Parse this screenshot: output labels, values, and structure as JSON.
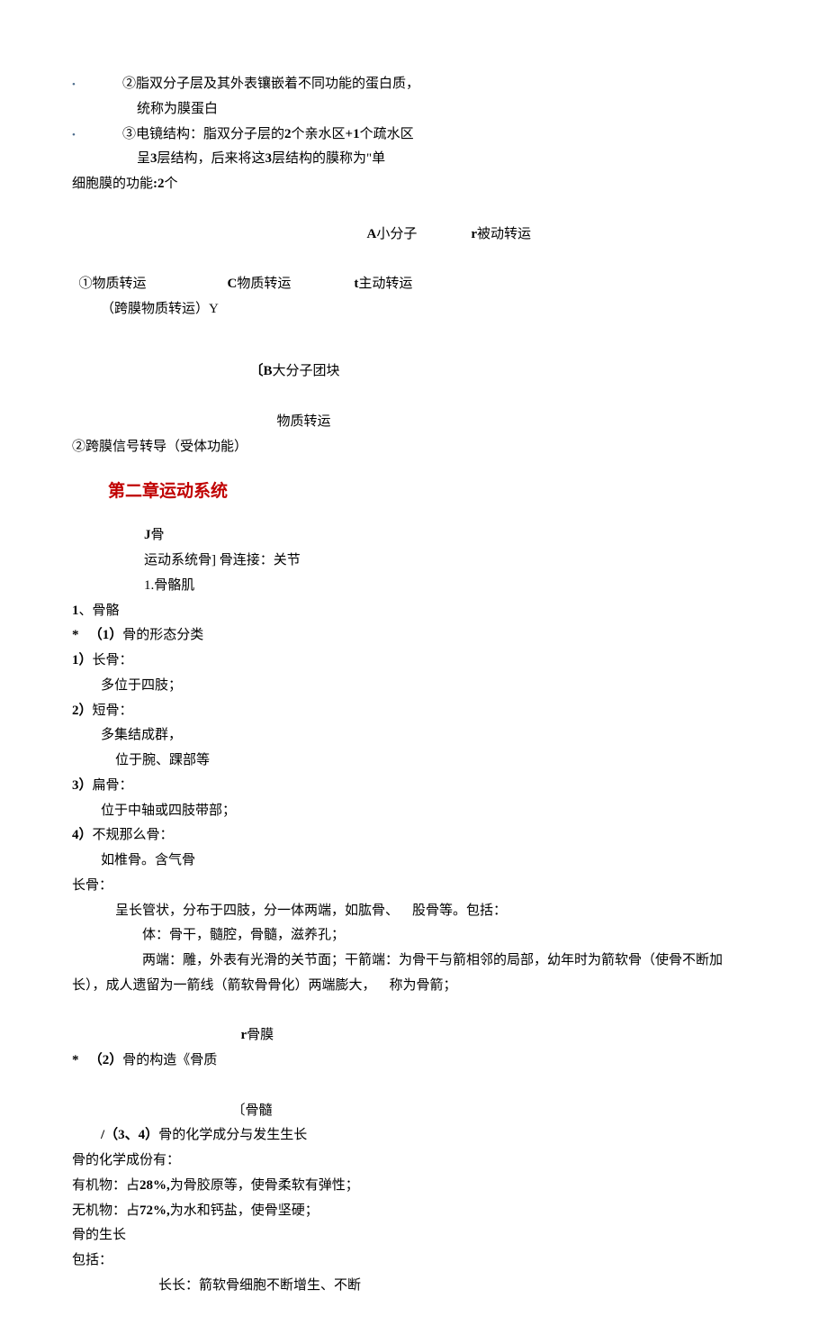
{
  "bullets": {
    "item2": "②脂双分子层及其外表镶嵌着不同功能的蛋白质，",
    "item2_cont": "统称为膜蛋白",
    "item3_a": "③电镜结构：脂双分子层的",
    "item3_b": "2",
    "item3_c": "个亲水区",
    "item3_d": "+1",
    "item3_e": "个疏水区",
    "item3_line2_a": "呈",
    "item3_line2_b": "3",
    "item3_line2_c": "层结构，后来将这",
    "item3_line2_d": "3",
    "item3_line2_e": "层结构的膜称为\"单"
  },
  "membrane_func": {
    "title_a": "细胞膜的功能",
    "title_b": ":2",
    "title_c": "个",
    "row1_A": "A",
    "row1_A_txt": "小分子",
    "row1_r": "r",
    "row1_r_txt": "被动转运",
    "row2_num": "①物质转运",
    "row2_C": "C",
    "row2_C_txt": "物质转运",
    "row2_t": "t",
    "row2_t_txt": "主动转运",
    "row3": "（跨膜物质转运）Y",
    "row4_B": "〔B",
    "row4_B_txt": "大分子团块",
    "row5_txt": "物质转运",
    "signal": "②跨膜信号转导（受体功能）"
  },
  "chapter2": "第二章运动系统",
  "motion": {
    "j": "J",
    "bone": "骨",
    "sys_a": "运动系统骨]",
    "sys_b": "骨连接：关节",
    "sk_muscle": "1.骨骼肌"
  },
  "skeleton": {
    "heading_num": "1",
    "heading_txt": "、骨骼",
    "star": "*",
    "morph_a": "（1）",
    "morph_b": "骨的形态分类",
    "long_num": "1）",
    "long_txt": "长骨：",
    "long_desc": "多位于四肢；",
    "short_num": "2）",
    "short_txt": "短骨：",
    "short_desc1": "多集结成群，",
    "short_desc2": "位于腕、踝部等",
    "flat_num": "3）",
    "flat_txt": "扁骨：",
    "flat_desc": "位于中轴或四肢带部；",
    "irr_num": "4）",
    "irr_txt": "不规那么骨：",
    "irr_desc": "如椎骨。含气骨"
  },
  "longbone": {
    "title": "长骨：",
    "line1_a": "呈长管状，分布于四肢，分一体两端，如肱骨、",
    "line1_b": "股骨等。包括：",
    "line2": "体：骨干，髓腔，骨髓，滋养孔；",
    "line3_a": "两端：雕，外表有光滑的关节面；干箭端：为骨干与箭相邻的局部，幼年时为箭软骨（使骨不断加长），成人遗留为一箭线（箭软骨骨化）两端膨大，",
    "line3_b": "称为骨箭；"
  },
  "structure": {
    "r": "r",
    "r_txt": "骨膜",
    "star": "*",
    "num": "（2）",
    "txt": "骨的构造《骨质",
    "marrow": "〔骨髓",
    "chem_num": "（3、4）",
    "chem_pre": "/",
    "chem_txt": "骨的化学成分与发生生长"
  },
  "chem": {
    "title": "骨的化学成份有：",
    "org_a": "有机物：占",
    "org_b": "28%,",
    "org_c": "为骨胶原等，使骨柔软有弹性；",
    "inorg_a": "无机物：占",
    "inorg_b": "72%,",
    "inorg_c": "为水和钙盐，使骨坚硬；"
  },
  "growth": {
    "title": "骨的生长",
    "inc": "包括：",
    "long": "长长：箭软骨细胞不断增生、不断"
  }
}
